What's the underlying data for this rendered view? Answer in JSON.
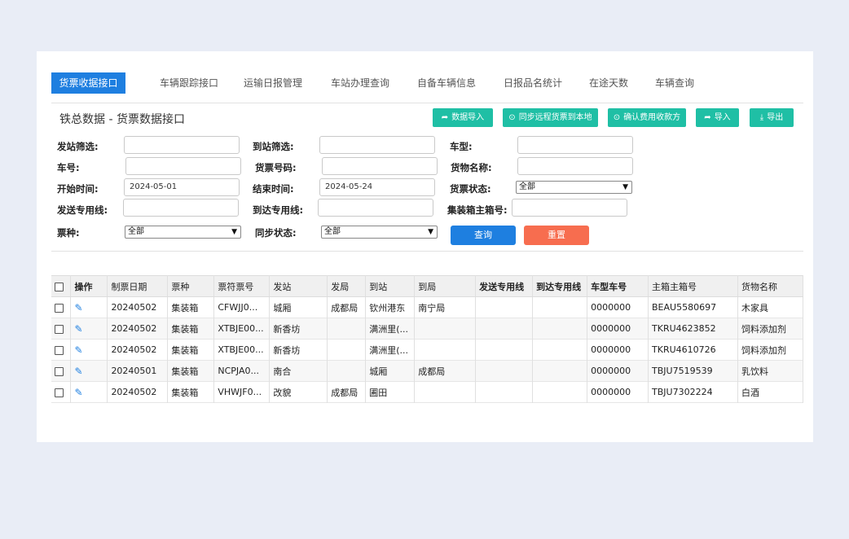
{
  "tabs": [
    "货票收据接口",
    "车辆跟踪接口",
    "运输日报管理",
    "车站办理查询",
    "自备车辆信息",
    "日报品名统计",
    "在途天数",
    "车辆查询"
  ],
  "title": "铁总数据 - 货票数据接口",
  "toolbar": {
    "import_data": "数据导入",
    "sync_remote": "同步远程货票到本地",
    "confirm_payee": "确认费用收款方",
    "import": "导入",
    "export": "导出"
  },
  "filters": {
    "from_station_label": "发站筛选:",
    "to_station_label": "到站筛选:",
    "car_type_label": "车型:",
    "car_no_label": "车号:",
    "ticket_no_label": "货票号码:",
    "goods_name_label": "货物名称:",
    "start_time_label": "开始时间:",
    "start_time_value": "2024-05-01",
    "end_time_label": "结束时间:",
    "end_time_value": "2024-05-24",
    "ticket_status_label": "货票状态:",
    "ticket_status_value": "全部",
    "send_line_label": "发送专用线:",
    "arrive_line_label": "到达专用线:",
    "container_label": "集装箱主箱号:",
    "ticket_kind_label": "票种:",
    "ticket_kind_value": "全部",
    "sync_status_label": "同步状态:",
    "sync_status_value": "全部",
    "query": "查询",
    "reset": "重置"
  },
  "colors": {
    "primary": "#1e7fe0",
    "teal": "#1fbfa5",
    "reset": "#f76d4f"
  },
  "table": {
    "headers": [
      "操作",
      "制票日期",
      "票种",
      "票符票号",
      "发站",
      "发局",
      "到站",
      "到局",
      "发送专用线",
      "到达专用线",
      "车型车号",
      "主箱主箱号",
      "货物名称"
    ],
    "rows": [
      [
        "20240502",
        "集装箱",
        "CFWJJ0...",
        "城厢",
        "成都局",
        "钦州港东",
        "南宁局",
        "",
        "",
        "0000000",
        "BEAU5580697",
        "木家具"
      ],
      [
        "20240502",
        "集装箱",
        "XTBJE00...",
        "新香坊",
        "",
        "满洲里(...",
        "",
        "",
        "",
        "0000000",
        "TKRU4623852",
        "饲料添加剂"
      ],
      [
        "20240502",
        "集装箱",
        "XTBJE00...",
        "新香坊",
        "",
        "满洲里(...",
        "",
        "",
        "",
        "0000000",
        "TKRU4610726",
        "饲料添加剂"
      ],
      [
        "20240501",
        "集装箱",
        "NCPJA0...",
        "南合",
        "",
        "城厢",
        "成都局",
        "",
        "",
        "0000000",
        "TBJU7519539",
        "乳饮料"
      ],
      [
        "20240502",
        "集装箱",
        "VHWJF0...",
        "改貌",
        "成都局",
        "圃田",
        "",
        "",
        "",
        "0000000",
        "TBJU7302224",
        "白酒"
      ]
    ]
  }
}
